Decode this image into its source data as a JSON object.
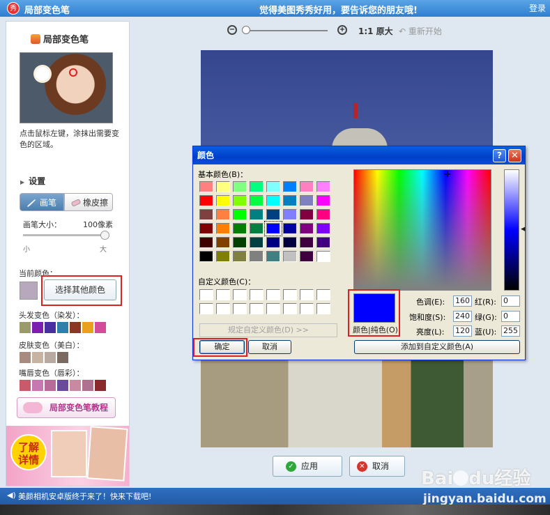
{
  "app": {
    "title": "局部变色笔",
    "center_message": "觉得美图秀秀好用，要告诉您的朋友哦!",
    "login": "登录",
    "logo_text": "秀"
  },
  "left": {
    "tool_title": "局部变色笔",
    "hint": "点击鼠标左键，涂抹出需要变色的区域。",
    "settings_label": "设置",
    "tab_brush": "画笔",
    "tab_eraser": "橡皮擦",
    "brush_size_label": "画笔大小：",
    "brush_size_value": "100像素",
    "brush_size_fraction": 1.0,
    "small_label": "小",
    "big_label": "大",
    "current_color_label": "当前颜色：",
    "current_color": "#b7a8bd",
    "choose_other_color": "选择其他颜色",
    "hair_label": "头发变色（染发）：",
    "hair_colors": [
      "#9a9a6a",
      "#7a1fb0",
      "#4a2fa3",
      "#2f7fa8",
      "#8a3a24",
      "#e8a11c",
      "#d24c9a"
    ],
    "skin_label": "皮肤变色（美白）：",
    "skin_colors": [
      "#a88a7e",
      "#c8b2a0",
      "#b8aaa0",
      "#7a6a60"
    ],
    "lip_label": "嘴唇变色（唇彩）：",
    "lip_colors": [
      "#c85a6a",
      "#c878b0",
      "#b86a98",
      "#6a4a9a",
      "#c88aa0",
      "#b07090",
      "#8a2a2a"
    ],
    "tutorial": "局部变色笔教程",
    "ad_badge_line1": "了解",
    "ad_badge_line2": "详情"
  },
  "toolbar": {
    "zoom_out": "−",
    "zoom_in": "+",
    "original_size": "1:1 原大",
    "restart": "重新开始"
  },
  "buttons": {
    "apply": "应用",
    "cancel": "取消"
  },
  "status": {
    "message": "美颜相机安卓版终于来了！快来下载吧!",
    "watermark": "jingyan.baidu.com",
    "baidu_logo_a": "Bai",
    "baidu_logo_b": "du",
    "baidu_logo_c": "经验"
  },
  "dialog": {
    "title": "颜色",
    "help": "?",
    "close": "✕",
    "basic_label": "基本颜色(B)：",
    "basic_colors": [
      "#ff8080",
      "#ffff80",
      "#80ff80",
      "#00ff80",
      "#80ffff",
      "#0080ff",
      "#ff80c0",
      "#ff80ff",
      "#ff0000",
      "#ffff00",
      "#80ff00",
      "#00ff40",
      "#00ffff",
      "#0080c0",
      "#8080c0",
      "#ff00ff",
      "#804040",
      "#ff8040",
      "#00ff00",
      "#008080",
      "#004080",
      "#8080ff",
      "#800040",
      "#ff0080",
      "#800000",
      "#ff8000",
      "#008000",
      "#008040",
      "#0000ff",
      "#0000a0",
      "#800080",
      "#8000ff",
      "#400000",
      "#804000",
      "#004000",
      "#004040",
      "#000080",
      "#000040",
      "#400040",
      "#400080",
      "#000000",
      "#808000",
      "#808040",
      "#808080",
      "#408080",
      "#c0c0c0",
      "#400040",
      "#ffffff"
    ],
    "selected_index": 28,
    "custom_label": "自定义颜色(C)：",
    "define_custom": "规定自定义颜色(D) >>",
    "ok": "确定",
    "cancel": "取消",
    "color_solid_label": "颜色|纯色(O)",
    "preview_color": "#0000ff",
    "hue_label": "色调(E):",
    "hue": "160",
    "sat_label": "饱和度(S):",
    "sat": "240",
    "lum_label": "亮度(L):",
    "lum": "120",
    "red_label": "红(R):",
    "red": "0",
    "green_label": "绿(G):",
    "green": "0",
    "blue_label": "蓝(U):",
    "blue": "255",
    "add_custom": "添加到自定义颜色(A)"
  }
}
